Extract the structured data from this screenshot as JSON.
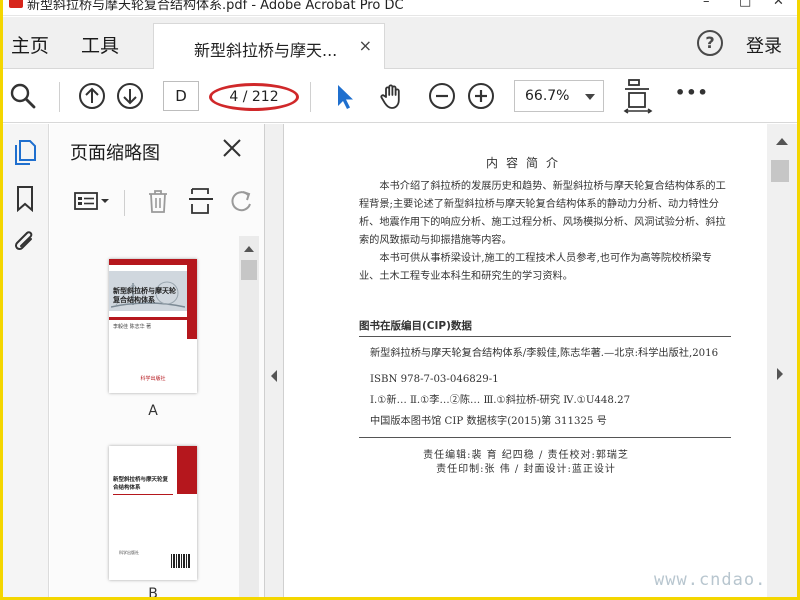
{
  "window": {
    "title": "新型斜拉桥与摩天轮复合结构体系.pdf - Adobe Acrobat Pro DC",
    "minimize": "–",
    "maximize": "□",
    "close": "✕"
  },
  "tabs": {
    "home": "主页",
    "tools": "工具",
    "document_tab": "新型斜拉桥与摩天...",
    "document_tab_close": "×",
    "help": "?",
    "login": "登录"
  },
  "toolbar": {
    "icons": [
      "search-icon",
      "prev-page-icon",
      "next-page-icon",
      "select-cursor-icon",
      "hand-tool-icon",
      "zoom-out-icon",
      "zoom-in-icon",
      "fit-page-icon",
      "more-icon"
    ],
    "page_input": "D",
    "page_count": "4 / 212",
    "zoom_value": "66.7%",
    "more": "•••",
    "accent_color": "#1f6fce",
    "highlight_color": "#d0282a"
  },
  "panel": {
    "title": "页面缩略图",
    "close": "×",
    "thumbnails": [
      {
        "label": "A",
        "cover_title": "新型斜拉桥与摩天轮复合结构体系",
        "authors": "李毅佳  陈志华 著",
        "publisher": "科学出版社"
      },
      {
        "label": "B",
        "cover_title": "新型斜拉桥与摩天轮复合结构体系",
        "publisher": "科学出版社"
      }
    ]
  },
  "page": {
    "heading": "内容简介",
    "paragraphs": [
      "本书介绍了斜拉桥的发展历史和趋势、新型斜拉桥与摩天轮复合结构体系的工程背景;主要论述了新型斜拉桥与摩天轮复合结构体系的静动力分析、动力特性分析、地震作用下的响应分析、施工过程分析、风场模拟分析、风洞试验分析、斜拉索的风致振动与抑振措施等内容。",
      "本书可供从事桥梁设计,施工的工程技术人员参考,也可作为高等院校桥梁专业、土木工程专业本科生和研究生的学习资料。"
    ],
    "cip_heading": "图书在版编目(CIP)数据",
    "cip_lines": [
      "新型斜拉桥与摩天轮复合结构体系/李毅佳,陈志华著.—北京:科学出版社,2016",
      "ISBN 978-7-03-046829-1",
      "Ⅰ.①新…  Ⅱ.①李…②陈…  Ⅲ.①斜拉桥-研究  Ⅳ.①U448.27",
      "中国版本图书馆 CIP 数据核字(2015)第 311325 号"
    ],
    "credits": [
      "责任编辑:裴  育   纪四稳 / 责任校对:郭瑞芝",
      "责任印制:张  伟 / 封面设计:蓝正设计"
    ],
    "watermark": "www.cndao.com"
  }
}
